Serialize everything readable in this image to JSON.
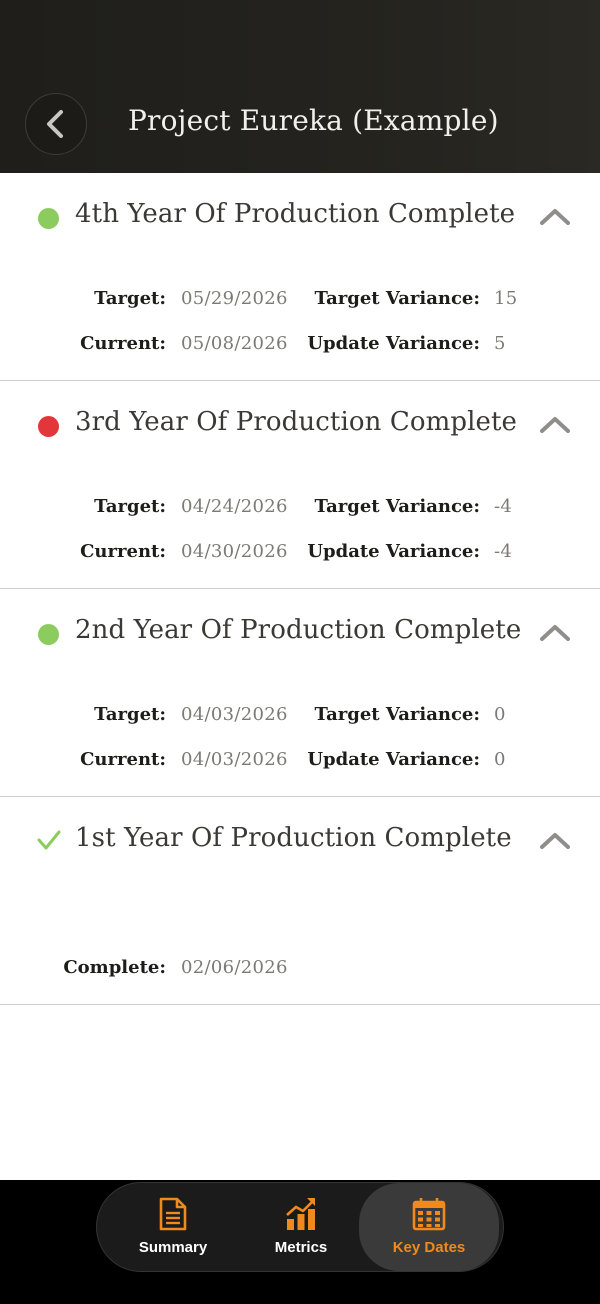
{
  "header": {
    "title": "Project Eureka (Example)"
  },
  "colors": {
    "on_track": "#8ccc5e",
    "off_track": "#e2363b",
    "complete_check": "#8ccc5e",
    "accent": "#f08a1c"
  },
  "labels": {
    "target": "Target:",
    "current": "Current:",
    "target_variance": "Target Variance:",
    "update_variance": "Update Variance:",
    "complete": "Complete:"
  },
  "milestones": [
    {
      "title": "4th Year Of Production Complete",
      "status": "on-track",
      "target": "05/29/2026",
      "current": "05/08/2026",
      "target_variance": "15",
      "update_variance": "5"
    },
    {
      "title": "3rd Year Of Production Complete",
      "status": "off-track",
      "target": "04/24/2026",
      "current": "04/30/2026",
      "target_variance": "-4",
      "update_variance": "-4"
    },
    {
      "title": "2nd Year Of Production Complete",
      "status": "on-track",
      "target": "04/03/2026",
      "current": "04/03/2026",
      "target_variance": "0",
      "update_variance": "0"
    },
    {
      "title": "1st Year Of Production Complete",
      "status": "complete",
      "complete": "02/06/2026"
    }
  ],
  "tabs": [
    {
      "label": "Summary",
      "icon": "document-icon",
      "active": false
    },
    {
      "label": "Metrics",
      "icon": "chart-icon",
      "active": false
    },
    {
      "label": "Key Dates",
      "icon": "calendar-icon",
      "active": true
    }
  ]
}
